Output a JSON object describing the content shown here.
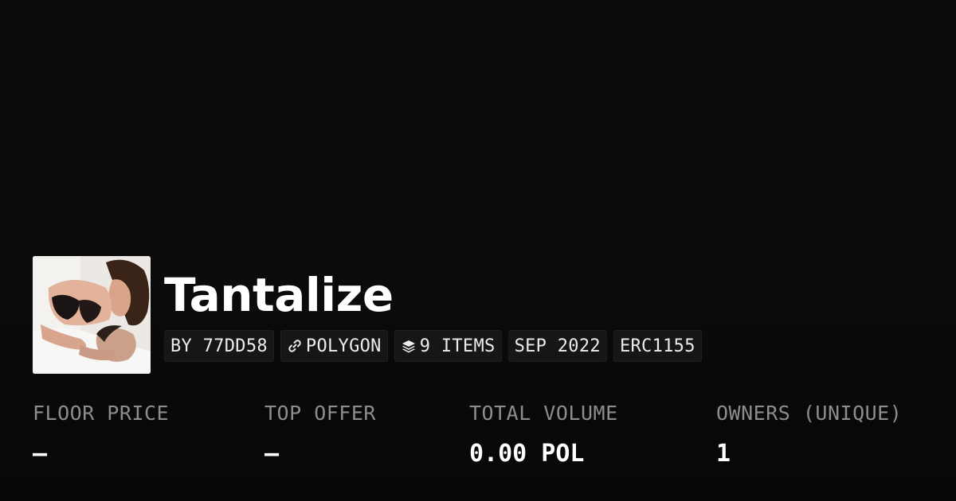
{
  "collection": {
    "name": "Tantalize",
    "avatar_icon": "collection-image"
  },
  "tags": {
    "creator": "BY 77DD58",
    "chain": "POLYGON",
    "chain_icon": "link-icon",
    "items": "9 ITEMS",
    "items_icon": "layers-icon",
    "date": "SEP 2022",
    "standard": "ERC1155"
  },
  "stats": {
    "floor_price": {
      "label": "FLOOR PRICE",
      "value": "–"
    },
    "top_offer": {
      "label": "TOP OFFER",
      "value": "–"
    },
    "total_volume": {
      "label": "TOTAL VOLUME",
      "value": "0.00 POL"
    },
    "owners": {
      "label": "OWNERS (UNIQUE)",
      "value": "1"
    }
  },
  "colors": {
    "background": "#0b0b0b",
    "tag_background": "#161616",
    "label_gray": "#8d8d8d",
    "text": "#ffffff"
  }
}
